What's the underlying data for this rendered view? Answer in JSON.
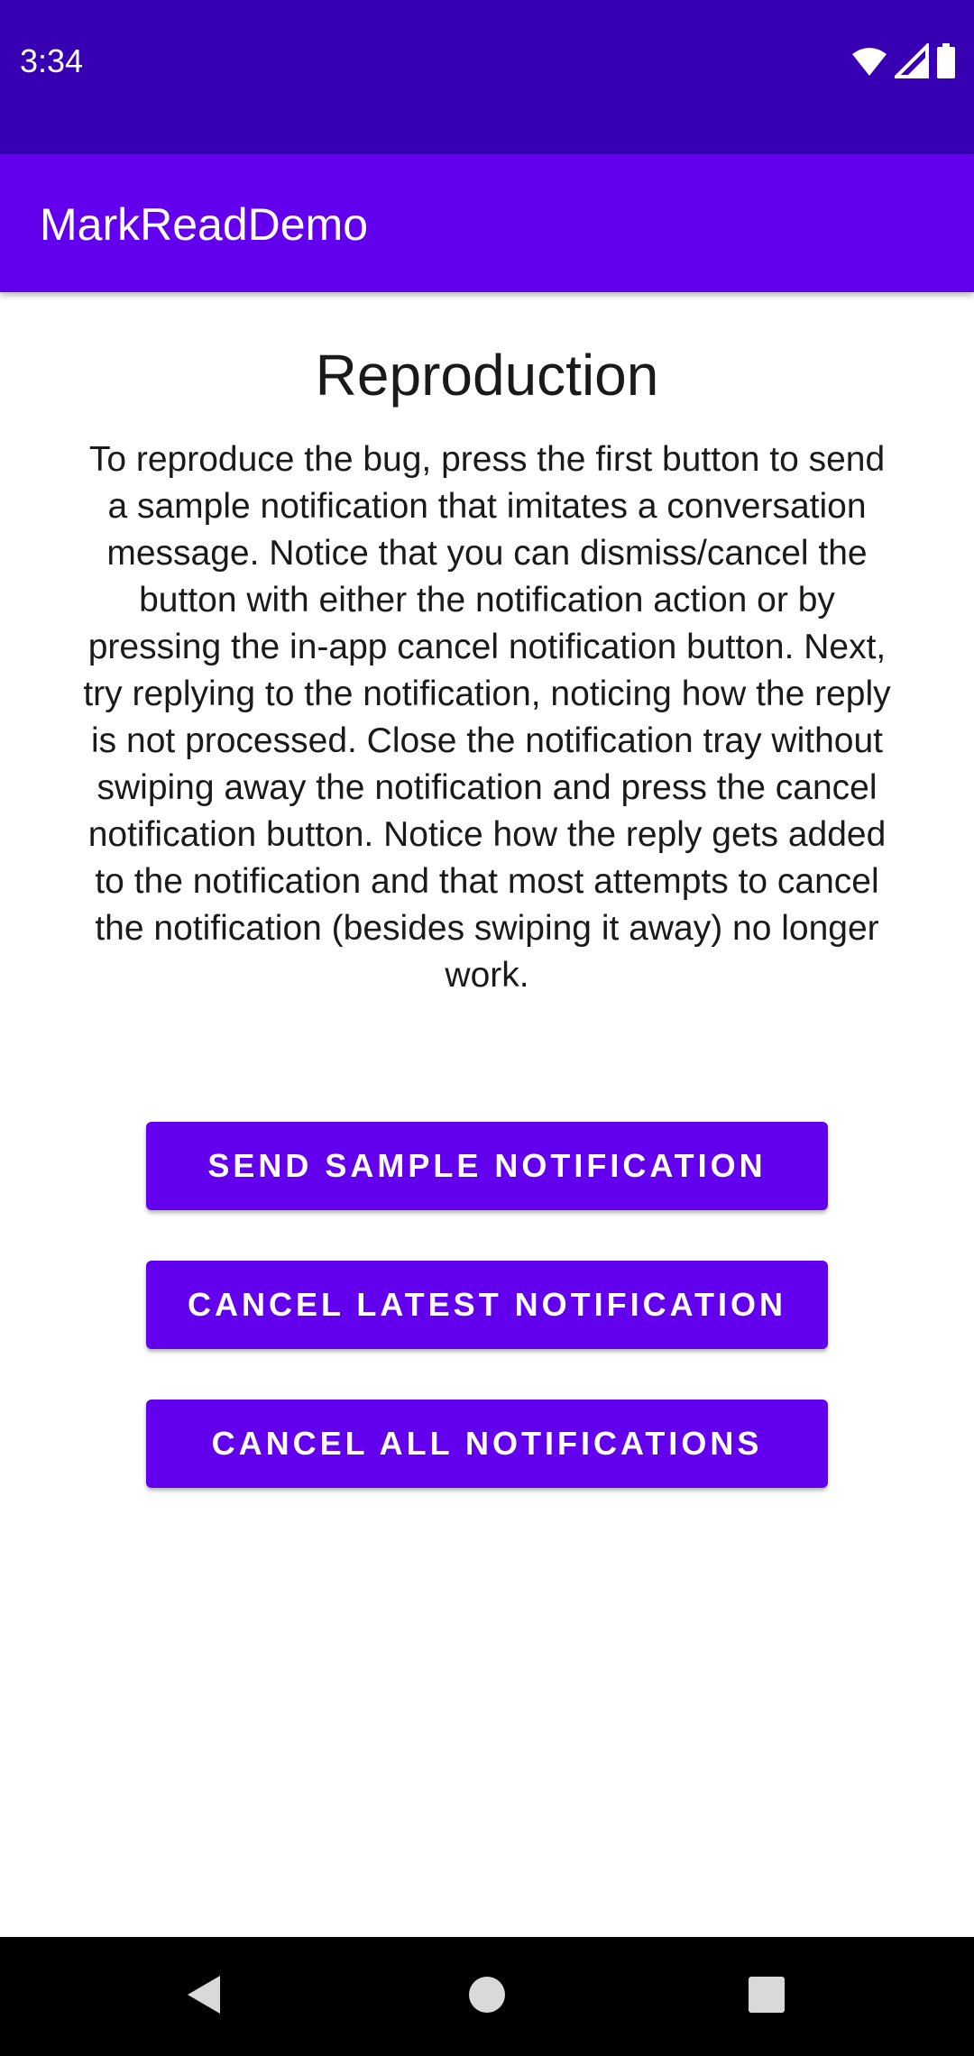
{
  "status_bar": {
    "time": "3:34",
    "icons": [
      "wifi-icon",
      "cellular-signal-icon",
      "battery-icon"
    ],
    "background": "#3700b3"
  },
  "app_bar": {
    "title": "MarkReadDemo",
    "background": "#6200ee"
  },
  "main": {
    "heading": "Reproduction",
    "description": "To reproduce the bug, press the first button to send a sample notification that imitates a conversation message. Notice that you can dismiss/cancel the button with either the notification action or by pressing the in-app cancel notification button. Next, try replying to the notification, noticing how the reply is not processed. Close the notification tray without swiping away the notification and press the cancel notification button. Notice how the reply gets added to the notification and that most attempts to cancel the notification (besides swiping it away) no longer work.",
    "buttons": {
      "send_sample": "SEND SAMPLE NOTIFICATION",
      "cancel_latest": "CANCEL LATEST NOTIFICATION",
      "cancel_all": "CANCEL ALL NOTIFICATIONS"
    },
    "button_color": "#6200ee"
  },
  "nav_bar": {
    "icons": [
      "back-icon",
      "home-icon",
      "recents-icon"
    ],
    "background": "#000000"
  }
}
